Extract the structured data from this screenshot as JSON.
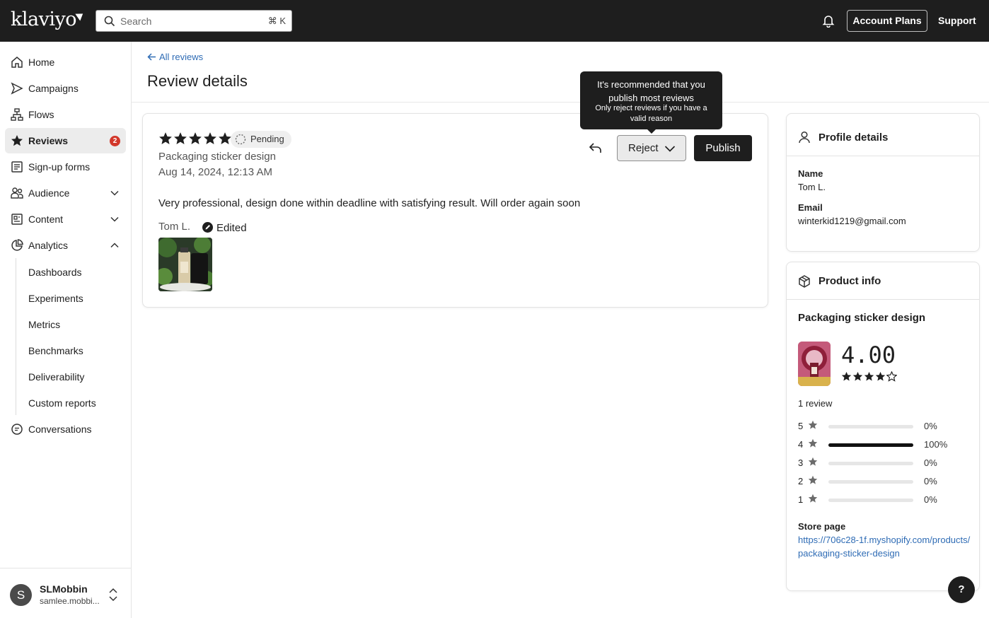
{
  "app": {
    "logo": "klaviyo"
  },
  "topbar": {
    "search_placeholder": "Search",
    "search_shortcut": "⌘ K",
    "account_plans": "Account Plans",
    "support": "Support"
  },
  "sidebar": {
    "items": [
      {
        "label": "Home",
        "icon": "home-icon"
      },
      {
        "label": "Campaigns",
        "icon": "send-icon"
      },
      {
        "label": "Flows",
        "icon": "flow-icon"
      },
      {
        "label": "Reviews",
        "icon": "star-icon",
        "badge": "2",
        "active": true
      },
      {
        "label": "Sign-up forms",
        "icon": "form-icon"
      },
      {
        "label": "Audience",
        "icon": "people-icon"
      },
      {
        "label": "Content",
        "icon": "content-icon"
      },
      {
        "label": "Analytics",
        "icon": "chart-icon"
      },
      {
        "label": "Conversations",
        "icon": "chat-icon"
      }
    ],
    "analytics_sub": [
      "Dashboards",
      "Experiments",
      "Metrics",
      "Benchmarks",
      "Deliverability",
      "Custom reports"
    ],
    "user": {
      "initial": "S",
      "name": "SLMobbin",
      "email": "samlee.mobbi..."
    }
  },
  "main": {
    "back_link": "All reviews",
    "title": "Review details"
  },
  "review": {
    "rating": 5,
    "status": "Pending",
    "product": "Packaging sticker design",
    "date": "Aug 14, 2024, 12:13 AM",
    "text": "Very professional, design done within deadline with satisfying result. Will order again soon",
    "author": "Tom L.",
    "edited": "Edited",
    "reject_label": "Reject",
    "publish_label": "Publish"
  },
  "tooltip": {
    "line1": "It's recommended that you publish most reviews",
    "line2": "Only reject reviews if you have a valid reason"
  },
  "profile": {
    "title": "Profile details",
    "name_label": "Name",
    "name": "Tom L.",
    "email_label": "Email",
    "email": "winterkid1219@gmail.com"
  },
  "product_info": {
    "title": "Product info",
    "name": "Packaging sticker design",
    "average": "4.00",
    "average_stars": 4,
    "review_count": "1 review",
    "distribution": [
      {
        "stars": "5",
        "percent": 0,
        "label": "0%"
      },
      {
        "stars": "4",
        "percent": 100,
        "label": "100%"
      },
      {
        "stars": "3",
        "percent": 0,
        "label": "0%"
      },
      {
        "stars": "2",
        "percent": 0,
        "label": "0%"
      },
      {
        "stars": "1",
        "percent": 0,
        "label": "0%"
      }
    ],
    "store_label": "Store page",
    "store_url": "https://706c28-1f.myshopify.com/products/packaging-sticker-design"
  },
  "help": "?"
}
